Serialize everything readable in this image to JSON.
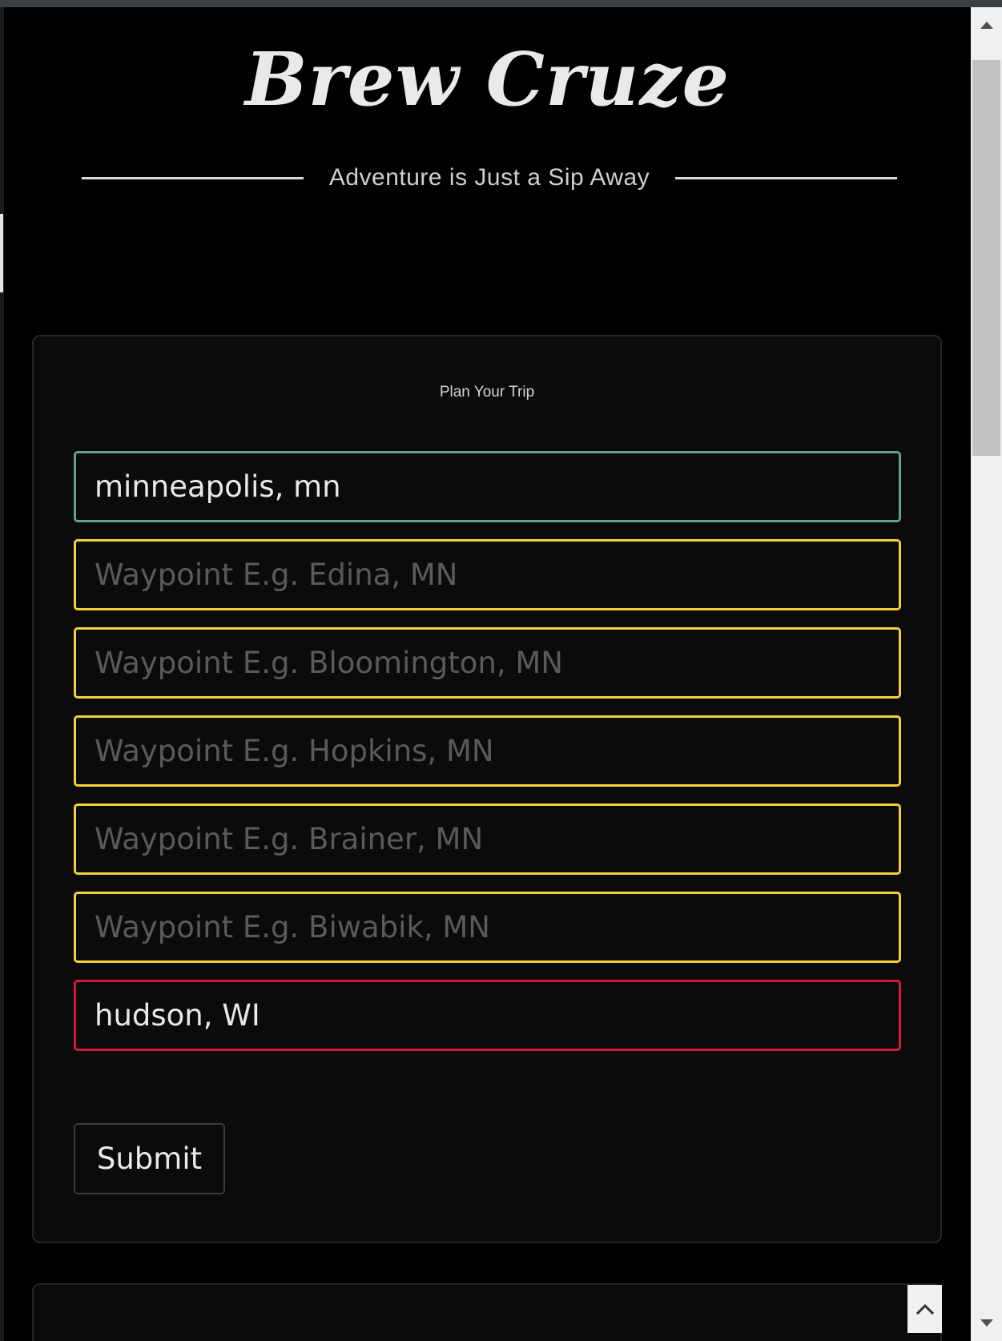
{
  "header": {
    "brand": "Brew Cruze",
    "tagline": "Adventure is Just a Sip Away"
  },
  "form": {
    "title": "Plan Your Trip",
    "start": {
      "value": "minneapolis, mn",
      "placeholder": ""
    },
    "waypoints": [
      {
        "value": "",
        "placeholder": "Waypoint E.g. Edina, MN"
      },
      {
        "value": "",
        "placeholder": "Waypoint E.g. Bloomington, MN"
      },
      {
        "value": "",
        "placeholder": "Waypoint E.g. Hopkins, MN"
      },
      {
        "value": "",
        "placeholder": "Waypoint E.g. Brainer, MN"
      },
      {
        "value": "",
        "placeholder": "Waypoint E.g. Biwabik, MN"
      }
    ],
    "end": {
      "value": "hudson, WI",
      "placeholder": ""
    },
    "submit_label": "Submit"
  },
  "icons": {
    "back_to_top": "chevron-up-icon",
    "scroll_up": "scroll-up-arrow-icon",
    "scroll_down": "scroll-down-arrow-icon"
  },
  "colors": {
    "start_border": "#5ea58c",
    "waypoint_border": "#f3d13a",
    "end_border": "#d6183c",
    "background": "#000000"
  }
}
